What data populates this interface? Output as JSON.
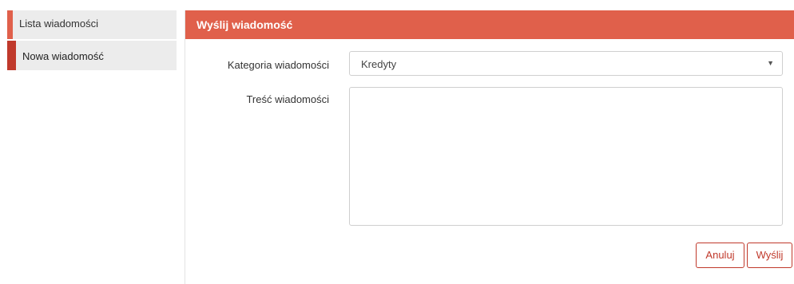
{
  "sidebar": {
    "items": [
      {
        "label": "Lista wiadomości",
        "active": false
      },
      {
        "label": "Nowa wiadomość",
        "active": true
      }
    ]
  },
  "panel": {
    "title": "Wyślij wiadomość",
    "category_label": "Kategoria wiadomości",
    "category_value": "Kredyty",
    "content_label": "Treść wiadomości",
    "content_value": ""
  },
  "buttons": {
    "cancel_label": "Anuluj",
    "send_label": "Wyślij"
  },
  "colors": {
    "accent": "#e0604b",
    "accent_dark": "#c0392b"
  }
}
